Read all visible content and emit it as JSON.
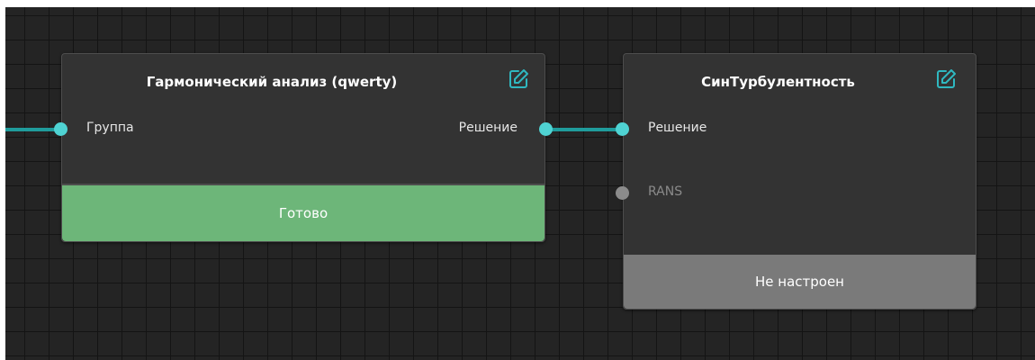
{
  "colors": {
    "canvas_background": "#242424",
    "grid_line": "#141414",
    "node_background": "#333333",
    "wire": "#1f9c9c",
    "port_active": "#4fd3d3",
    "port_inactive": "#8c8c8c",
    "status_ready": "#6db679",
    "status_not_configured": "#7a7a7a",
    "edit_icon": "#2fb8c0"
  },
  "nodes": [
    {
      "title": "Гармонический анализ (qwerty)",
      "edit_icon": "edit-pencil-icon",
      "inputs": [
        {
          "label": "Группа",
          "active": true
        }
      ],
      "outputs": [
        {
          "label": "Решение",
          "active": true
        }
      ],
      "status": "Готово"
    },
    {
      "title": "СинТурбулентность",
      "edit_icon": "edit-pencil-icon",
      "inputs": [
        {
          "label": "Решение",
          "active": true
        },
        {
          "label": "RANS",
          "active": false
        }
      ],
      "outputs": [],
      "status": "Не настроен"
    }
  ]
}
